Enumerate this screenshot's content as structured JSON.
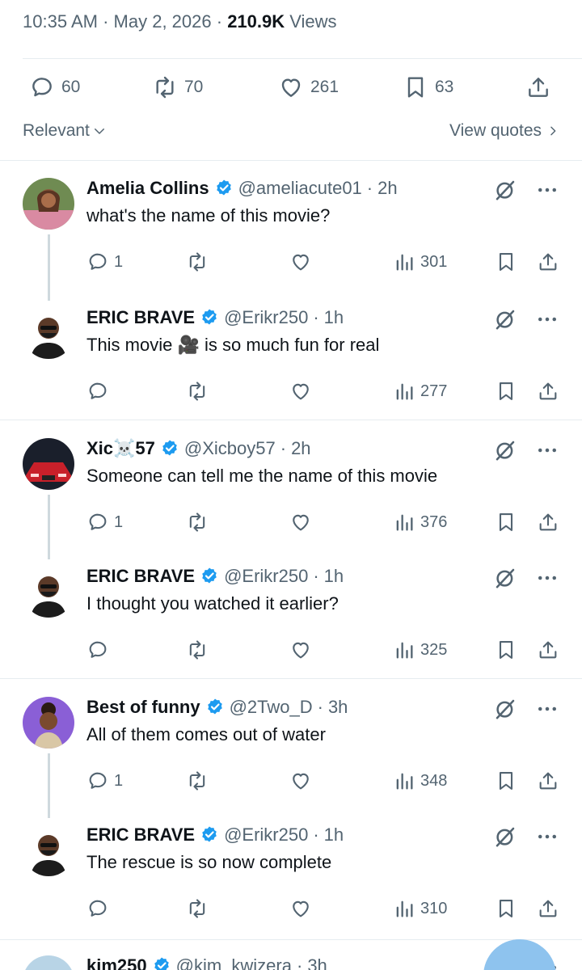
{
  "post_meta": {
    "time": "10:35 AM",
    "date": "May 2, 2026",
    "views_count": "210.9K",
    "views_label": "Views"
  },
  "engagement": {
    "replies": "60",
    "reposts": "70",
    "likes": "261",
    "bookmarks": "63"
  },
  "sort": {
    "label": "Relevant",
    "view_quotes": "View quotes"
  },
  "colors": {
    "verified": "#1d9bf0",
    "secondary_text": "#536471",
    "divider": "#e6ecf0"
  },
  "replies": [
    {
      "name": "Amelia Collins",
      "handle": "@ameliacute01",
      "time": "2h",
      "text": "what's the name of this movie?",
      "reply_count": "1",
      "views": "301"
    },
    {
      "name": "ERIC BRAVE",
      "handle": "@Erikr250",
      "time": "1h",
      "text": "This movie 🎥 is so much fun for real",
      "reply_count": "",
      "views": "277"
    },
    {
      "name": "Xic☠️57",
      "handle": "@Xicboy57",
      "time": "2h",
      "text": "Someone can tell me the name of this movie",
      "reply_count": "1",
      "views": "376"
    },
    {
      "name": "ERIC BRAVE",
      "handle": "@Erikr250",
      "time": "1h",
      "text": "I thought you watched it earlier?",
      "reply_count": "",
      "views": "325"
    },
    {
      "name": "Best of funny",
      "handle": "@2Two_D",
      "time": "3h",
      "text": "All of them comes out of water",
      "reply_count": "1",
      "views": "348"
    },
    {
      "name": "ERIC BRAVE",
      "handle": "@Erikr250",
      "time": "1h",
      "text": "The rescue is so now complete",
      "reply_count": "",
      "views": "310"
    },
    {
      "name": "kim250",
      "handle": "@kim_kwizera",
      "time": "3h",
      "text": "",
      "reply_count": "",
      "views": ""
    }
  ],
  "separators": {
    "dot": "·"
  }
}
